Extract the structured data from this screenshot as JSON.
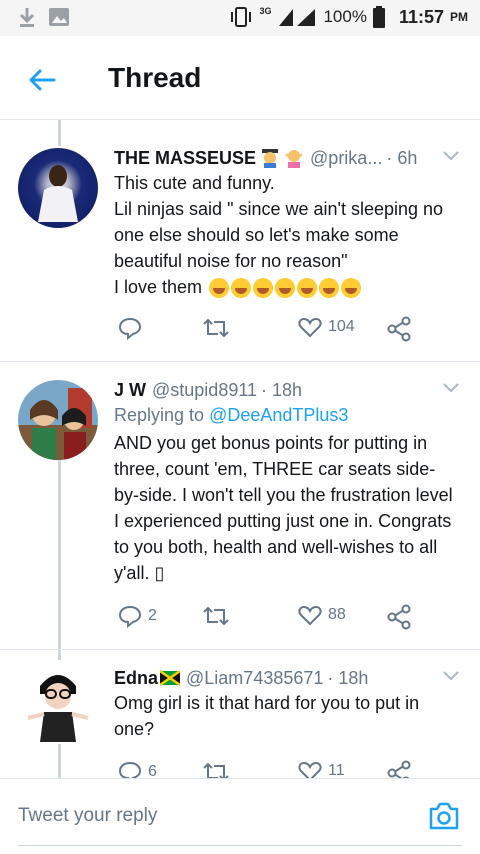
{
  "status_bar": {
    "network": "3G",
    "battery": "100%",
    "time": "11:57",
    "ampm": "PM"
  },
  "header": {
    "title": "Thread"
  },
  "tweets": [
    {
      "name": "THE MASSEUSE",
      "handle": "@prika...",
      "time": "· 6h",
      "text": "This cute and funny.\nLil ninjas said \" since we ain't sleeping no one else should so let's make some beautiful noise for no reason\"\nI love them",
      "emojis": [
        "rolling-on-floor-laughing",
        "tears-of-joy",
        "tears-of-joy",
        "tears-of-joy",
        "tears-of-joy",
        "tears-of-joy",
        "tears-of-joy"
      ],
      "replies": "",
      "retweets": "",
      "likes": "104"
    },
    {
      "name": "J W",
      "handle": "@stupid8911",
      "time": "· 18h",
      "replying_prefix": "Replying to",
      "replying_to": "@DeeAndTPlus3",
      "text": "AND you get bonus points for putting in three, count 'em, THREE car seats side-by-side. I won't tell you the frustration level I experienced putting just one in. Congrats to you both, health and well-wishes to all y'all. ▯",
      "replies": "2",
      "retweets": "",
      "likes": "88"
    },
    {
      "name": "Edna",
      "handle": "@Liam74385671",
      "time": "· 18h",
      "text": "Omg girl is it that hard for you to put in one?",
      "replies": "6",
      "retweets": "",
      "likes": "11"
    }
  ],
  "reply_bar": {
    "placeholder": "Tweet your reply"
  },
  "colors": {
    "accent": "#1da1f2",
    "secondary_text": "#657786",
    "divider": "#e1e8ed"
  }
}
